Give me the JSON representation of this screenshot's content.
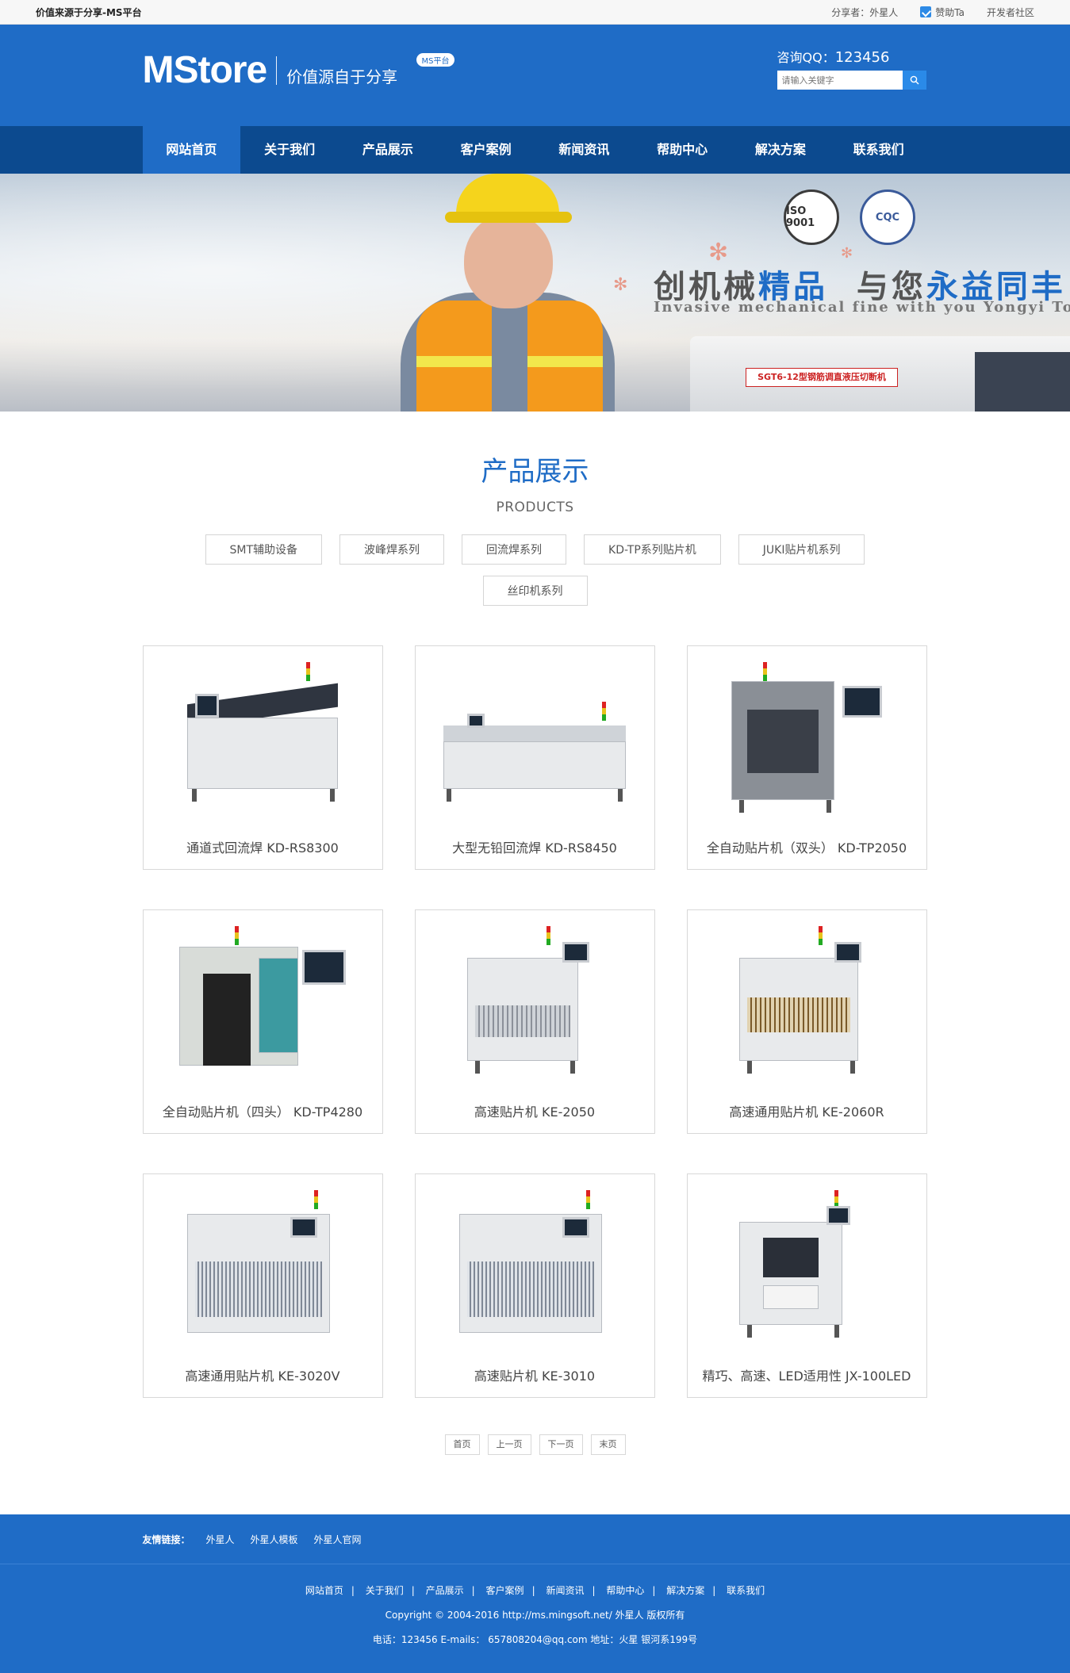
{
  "topbar": {
    "slogan": "价值来源于分享-MS平台",
    "sharer": "分享者：外星人",
    "praise": "赞助Ta",
    "community": "开发者社区"
  },
  "header": {
    "logo": "MStore",
    "tagline": "价值源自于分享",
    "badge": "MS平台",
    "qq_label": "咨询QQ：",
    "qq_number": "123456",
    "search_placeholder": "请输入关键字"
  },
  "nav": {
    "items": [
      {
        "label": "网站首页",
        "active": true
      },
      {
        "label": "关于我们"
      },
      {
        "label": "产品展示"
      },
      {
        "label": "客户案例"
      },
      {
        "label": "新闻资讯"
      },
      {
        "label": "帮助中心"
      },
      {
        "label": "解决方案"
      },
      {
        "label": "联系我们"
      }
    ]
  },
  "banner": {
    "title_part1": "创机械",
    "title_hl1": "精品",
    "title_part2": "与您",
    "title_hl2": "永益同丰",
    "subtitle": "Invasive mechanical fine with you Yongyi TongFeng",
    "badge_iso": "ISO 9001",
    "badge_cqc": "CQC",
    "plate": "SGT6-12型钢筋调直液压切断机"
  },
  "section": {
    "title": "产品展示",
    "subtitle": "PRODUCTS"
  },
  "categories": [
    "SMT辅助设备",
    "波峰焊系列",
    "回流焊系列",
    "KD-TP系列贴片机",
    "JUKI贴片机系列",
    "丝印机系列"
  ],
  "products": [
    {
      "name": "通道式回流焊 KD-RS8300"
    },
    {
      "name": "大型无铅回流焊 KD-RS8450"
    },
    {
      "name": "全自动贴片机（双头） KD-TP2050"
    },
    {
      "name": "全自动贴片机（四头） KD-TP4280"
    },
    {
      "name": "高速贴片机 KE-2050"
    },
    {
      "name": "高速通用贴片机 KE-2060R"
    },
    {
      "name": "高速通用贴片机 KE-3020V"
    },
    {
      "name": "高速贴片机 KE-3010"
    },
    {
      "name": "精巧、高速、LED适用性 JX-100LED"
    }
  ],
  "pager": {
    "first": "首页",
    "prev": "上一页",
    "next": "下一页",
    "last": "末页"
  },
  "footer": {
    "friends_label": "友情链接：",
    "friends": [
      "外星人",
      "外星人模板",
      "外星人官网"
    ],
    "nav": [
      "网站首页",
      "关于我们",
      "产品展示",
      "客户案例",
      "新闻资讯",
      "帮助中心",
      "解决方案",
      "联系我们"
    ],
    "copyright": "Copyright © 2004-2016 http://ms.mingsoft.net/ 外星人 版权所有",
    "contact": "电话：123456 E-mails： 657808204@qq.com 地址：火星 银河系199号"
  },
  "colors": {
    "brand_blue": "#1f6cc6",
    "nav_dark": "#0c4a8f"
  }
}
